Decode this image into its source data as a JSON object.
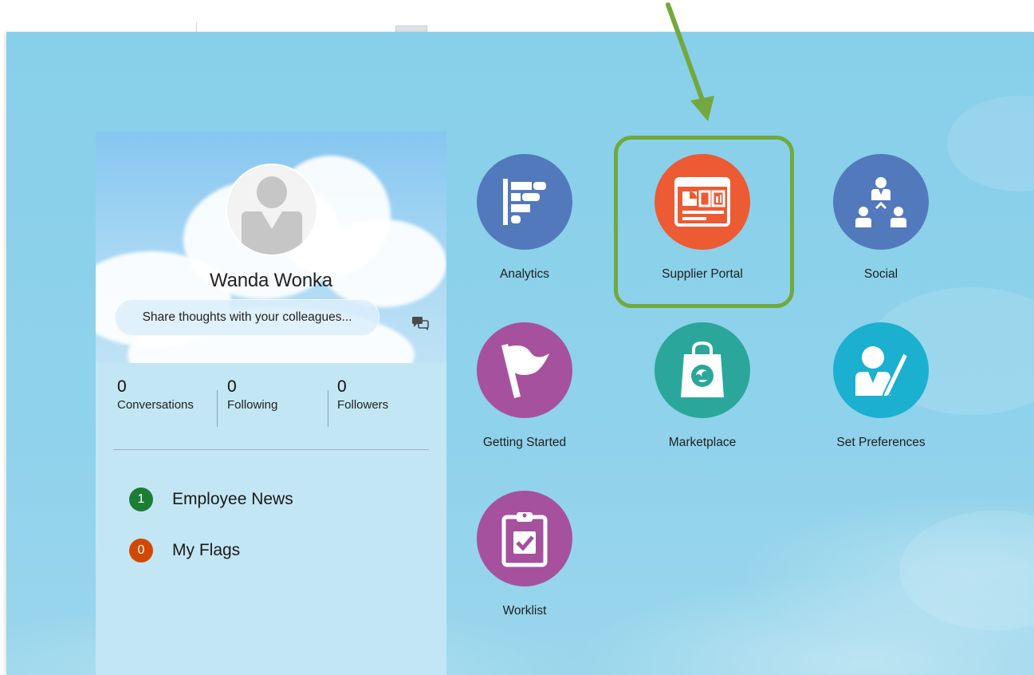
{
  "user": {
    "name": "Wanda Wonka",
    "share_placeholder": "Share thoughts with your colleagues..."
  },
  "stats": [
    {
      "count": "0",
      "label": "Conversations"
    },
    {
      "count": "0",
      "label": "Following"
    },
    {
      "count": "0",
      "label": "Followers"
    }
  ],
  "news": [
    {
      "count": "1",
      "label": "Employee News",
      "color": "#1e7d35"
    },
    {
      "count": "0",
      "label": "My Flags",
      "color": "#d34800"
    }
  ],
  "apps": [
    {
      "label": "Analytics",
      "icon": "analytics-icon",
      "color": "#5379bd"
    },
    {
      "label": "Supplier Portal",
      "icon": "supplier-portal-icon",
      "color": "#ec5b33"
    },
    {
      "label": "Social",
      "icon": "social-icon",
      "color": "#5379bd"
    },
    {
      "label": "Getting Started",
      "icon": "flag-icon",
      "color": "#a6519e"
    },
    {
      "label": "Marketplace",
      "icon": "shopping-bag-icon",
      "color": "#2aa79a"
    },
    {
      "label": "Set Preferences",
      "icon": "user-edit-icon",
      "color": "#1bb0cf"
    },
    {
      "label": "Worklist",
      "icon": "clipboard-check-icon",
      "color": "#a6519e"
    }
  ],
  "annotation": {
    "highlight_color": "#72a83e"
  }
}
